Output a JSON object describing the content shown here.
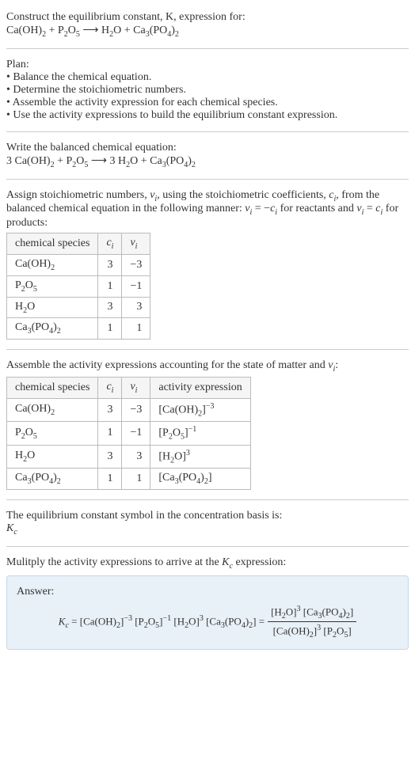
{
  "intro": {
    "line1": "Construct the equilibrium constant, K, expression for:",
    "equation_lhs1": "Ca(OH)",
    "equation_lhs1_sub": "2",
    "plus1": " + P",
    "p_sub1": "2",
    "o": "O",
    "p_sub2": "5",
    "arrow": " ⟶ ",
    "rhs1": "H",
    "rhs1_sub": "2",
    "rhs_o": "O + Ca",
    "ca_sub": "3",
    "po": "(PO",
    "po_sub1": "4",
    "close": ")",
    "po_sub2": "2"
  },
  "plan": {
    "header": "Plan:",
    "b1": "• Balance the chemical equation.",
    "b2": "• Determine the stoichiometric numbers.",
    "b3": "• Assemble the activity expression for each chemical species.",
    "b4": "• Use the activity expressions to build the equilibrium constant expression."
  },
  "balanced": {
    "header": "Write the balanced chemical equation:",
    "c1": "3 Ca(OH)",
    "s1": "2",
    "t1": " + P",
    "s2": "2",
    "t2": "O",
    "s3": "5",
    "arrow": " ⟶ ",
    "t3": "3 H",
    "s4": "2",
    "t4": "O + Ca",
    "s5": "3",
    "t5": "(PO",
    "s6": "4",
    "t6": ")",
    "s7": "2"
  },
  "assign": {
    "text1": "Assign stoichiometric numbers, ",
    "nu": "ν",
    "sub_i": "i",
    "text2": ", using the stoichiometric coefficients, ",
    "c": "c",
    "text3": ", from the balanced chemical equation in the following manner: ",
    "eq1a": "ν",
    "eq1b": " = −",
    "eq1c": "c",
    "text4": " for reactants and ",
    "eq2a": "ν",
    "eq2b": " = ",
    "eq2c": "c",
    "text5": " for products:"
  },
  "table1": {
    "h1": "chemical species",
    "h2": "c",
    "h2sub": "i",
    "h3": "ν",
    "h3sub": "i",
    "rows": [
      {
        "sp_a": "Ca(OH)",
        "sp_b": "2",
        "c": "3",
        "nu": "−3"
      },
      {
        "sp_a": "P",
        "sp_b": "2",
        "sp_c": "O",
        "sp_d": "5",
        "c": "1",
        "nu": "−1"
      },
      {
        "sp_a": "H",
        "sp_b": "2",
        "sp_c": "O",
        "c": "3",
        "nu": "3"
      },
      {
        "sp_a": "Ca",
        "sp_b": "3",
        "sp_c": "(PO",
        "sp_d": "4",
        "sp_e": ")",
        "sp_f": "2",
        "c": "1",
        "nu": "1"
      }
    ]
  },
  "assemble": {
    "text1": "Assemble the activity expressions accounting for the state of matter and ",
    "nu": "ν",
    "sub_i": "i",
    "colon": ":"
  },
  "table2": {
    "h1": "chemical species",
    "h2": "c",
    "h2sub": "i",
    "h3": "ν",
    "h3sub": "i",
    "h4": "activity expression",
    "rows": [
      {
        "c": "3",
        "nu": "−3",
        "ae_a": "[Ca(OH)",
        "ae_b": "2",
        "ae_c": "]",
        "ae_sup": "−3"
      },
      {
        "c": "1",
        "nu": "−1",
        "ae_a": "[P",
        "ae_b": "2",
        "ae_c": "O",
        "ae_d": "5",
        "ae_e": "]",
        "ae_sup": "−1"
      },
      {
        "c": "3",
        "nu": "3",
        "ae_a": "[H",
        "ae_b": "2",
        "ae_c": "O]",
        "ae_sup": "3"
      },
      {
        "c": "1",
        "nu": "1",
        "ae_a": "[Ca",
        "ae_b": "3",
        "ae_c": "(PO",
        "ae_d": "4",
        "ae_e": ")",
        "ae_f": "2",
        "ae_g": "]"
      }
    ]
  },
  "kc_symbol": {
    "line1": "The equilibrium constant symbol in the concentration basis is:",
    "sym": "K",
    "sub": "c"
  },
  "multiply": {
    "text": "Mulitply the activity expressions to arrive at the ",
    "k": "K",
    "sub": "c",
    "text2": " expression:"
  },
  "answer": {
    "label": "Answer:",
    "k": "K",
    "ksub": "c",
    "eq": " = [Ca(OH)",
    "s1": "2",
    "t1": "]",
    "sup1": "−3",
    "t2": " [P",
    "s2": "2",
    "t3": "O",
    "s3": "5",
    "t4": "]",
    "sup2": "−1",
    "t5": " [H",
    "s4": "2",
    "t6": "O]",
    "sup3": "3",
    "t7": " [Ca",
    "s5": "3",
    "t8": "(PO",
    "s6": "4",
    "t9": ")",
    "s7": "2",
    "t10": "] = ",
    "num_a": "[H",
    "num_b": "2",
    "num_c": "O]",
    "num_sup": "3",
    "num_d": " [Ca",
    "num_e": "3",
    "num_f": "(PO",
    "num_g": "4",
    "num_h": ")",
    "num_i": "2",
    "num_j": "]",
    "den_a": "[Ca(OH)",
    "den_b": "2",
    "den_c": "]",
    "den_sup": "3",
    "den_d": " [P",
    "den_e": "2",
    "den_f": "O",
    "den_g": "5",
    "den_h": "]"
  },
  "chart_data": {
    "type": "table",
    "tables": [
      {
        "title": "stoichiometric numbers",
        "columns": [
          "chemical species",
          "c_i",
          "nu_i"
        ],
        "rows": [
          [
            "Ca(OH)2",
            3,
            -3
          ],
          [
            "P2O5",
            1,
            -1
          ],
          [
            "H2O",
            3,
            3
          ],
          [
            "Ca3(PO4)2",
            1,
            1
          ]
        ]
      },
      {
        "title": "activity expressions",
        "columns": [
          "chemical species",
          "c_i",
          "nu_i",
          "activity expression"
        ],
        "rows": [
          [
            "Ca(OH)2",
            3,
            -3,
            "[Ca(OH)2]^-3"
          ],
          [
            "P2O5",
            1,
            -1,
            "[P2O5]^-1"
          ],
          [
            "H2O",
            3,
            3,
            "[H2O]^3"
          ],
          [
            "Ca3(PO4)2",
            1,
            1,
            "[Ca3(PO4)2]"
          ]
        ]
      }
    ]
  }
}
